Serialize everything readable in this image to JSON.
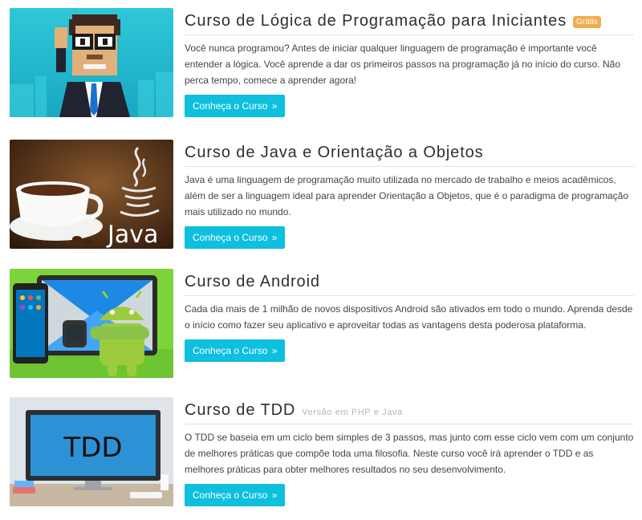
{
  "courses": [
    {
      "title": "Curso de Lógica de Programação para Iniciantes",
      "badge": "Grátis",
      "description": "Você nunca programou? Antes de iniciar qualquer linguagem de programação é importante você entender a lógica. Você aprende a dar os primeiros passos na programação já no início do curso. Não perca tempo, comece a aprender agora!",
      "button_label": "Conheça o Curso",
      "button_icon": "»"
    },
    {
      "title": "Curso de Java e Orientação a Objetos",
      "description": "Java é uma linguagem de programação muito utilizada no mercado de trabalho e meios acadêmicos, além de ser a linguagem ideal para aprender Orientação a Objetos, que é o paradigma de programação mais utilizado no mundo.",
      "button_label": "Conheça o Curso",
      "button_icon": "»",
      "image_text": "Java"
    },
    {
      "title": "Curso de Android",
      "description": "Cada dia mais de 1 milhão de novos dispositivos Android são ativados em todo o mundo. Aprenda desde o início como fazer seu aplicativo e aproveitar todas as vantagens desta poderosa plataforma.",
      "button_label": "Conheça o Curso",
      "button_icon": "»"
    },
    {
      "title": "Curso de TDD",
      "subtitle": "Versão em PHP e Java",
      "description": "O TDD se baseia em um ciclo bem simples de 3 passos, mas junto com esse ciclo vem com um conjunto de melhores práticas que compõe toda uma filosofia. Neste curso você irá aprender o TDD e as melhores práticas para obter melhores resultados no seu desenvolvimento.",
      "button_label": "Conheça o Curso",
      "button_icon": "»",
      "image_text": "TDD"
    }
  ],
  "colors": {
    "button": "#0ebfde",
    "badge": "#f0ad4e"
  }
}
